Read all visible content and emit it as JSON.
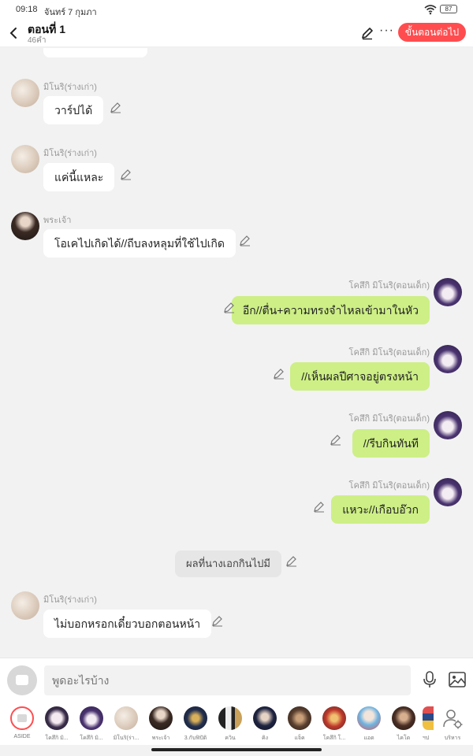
{
  "status_bar": {
    "time": "09:18",
    "date": "จันทร์ 7 กุมภา",
    "battery": "87"
  },
  "header": {
    "title": "ตอนที่ 1",
    "subtitle": "46คำ",
    "more_label": "···",
    "next_button": "ขั้นตอนต่อไป"
  },
  "chat": {
    "messages": [
      {
        "speaker": "มิโนริ(ร่างเก่า)",
        "text": "วาร์ปได้",
        "side": "left"
      },
      {
        "speaker": "มิโนริ(ร่างเก่า)",
        "text": "แค่นี้แหละ",
        "side": "left"
      },
      {
        "speaker": "พระเจ้า",
        "text": "โอเคไปเกิดได้//ถีบลงหลุมที่ใช้ไปเกิด",
        "side": "left"
      },
      {
        "speaker": "โคสึกิ มิโนริ(ตอนเด็ก)",
        "text": "อีก//ตื่น+ความทรงจำไหลเข้ามาในหัว",
        "side": "right"
      },
      {
        "speaker": "โคสึกิ มิโนริ(ตอนเด็ก)",
        "text": "//เห็นผลปีศาจอยู่ตรงหน้า",
        "side": "right"
      },
      {
        "speaker": "โคสึกิ มิโนริ(ตอนเด็ก)",
        "text": "//รีบกินทันที",
        "side": "right"
      },
      {
        "speaker": "โคสึกิ มิโนริ(ตอนเด็ก)",
        "text": "แหวะ//เกือบอ๊วก",
        "side": "right"
      },
      {
        "speaker": "",
        "text": "ผลที่นางเอกกินไปมี",
        "side": "center"
      },
      {
        "speaker": "มิโนริ(ร่างเก่า)",
        "text": "ไม่บอกหรอกเดี๋ยวบอกตอนหน้า",
        "side": "left"
      }
    ]
  },
  "composer": {
    "placeholder": "พูดอะไรบ้าง"
  },
  "characters": [
    {
      "label": "ASIDE",
      "icon": "aside-icon"
    },
    {
      "label": "โคสึกิ มิ...",
      "icon": "avatar"
    },
    {
      "label": "โคสึกิ มิ...",
      "icon": "avatar"
    },
    {
      "label": "มิโนริ(ร่า...",
      "icon": "avatar"
    },
    {
      "label": "พระเจ้า",
      "icon": "avatar"
    },
    {
      "label": "3.กับฟิปัติ",
      "icon": "avatar"
    },
    {
      "label": "ควิน",
      "icon": "avatar"
    },
    {
      "label": "คิง",
      "icon": "avatar"
    },
    {
      "label": "แจ็ค",
      "icon": "avatar"
    },
    {
      "label": "โคสึกิ โ...",
      "icon": "avatar"
    },
    {
      "label": "แอด",
      "icon": "avatar"
    },
    {
      "label": "ไคโด",
      "icon": "avatar"
    },
    {
      "label": "ฯป",
      "icon": "avatar"
    },
    {
      "label": "บริหาร",
      "icon": "manage-characters-icon"
    }
  ],
  "colors": {
    "accent": "#ff4d4f",
    "my_bubble": "#cdef86",
    "other_bubble": "#ffffff"
  }
}
